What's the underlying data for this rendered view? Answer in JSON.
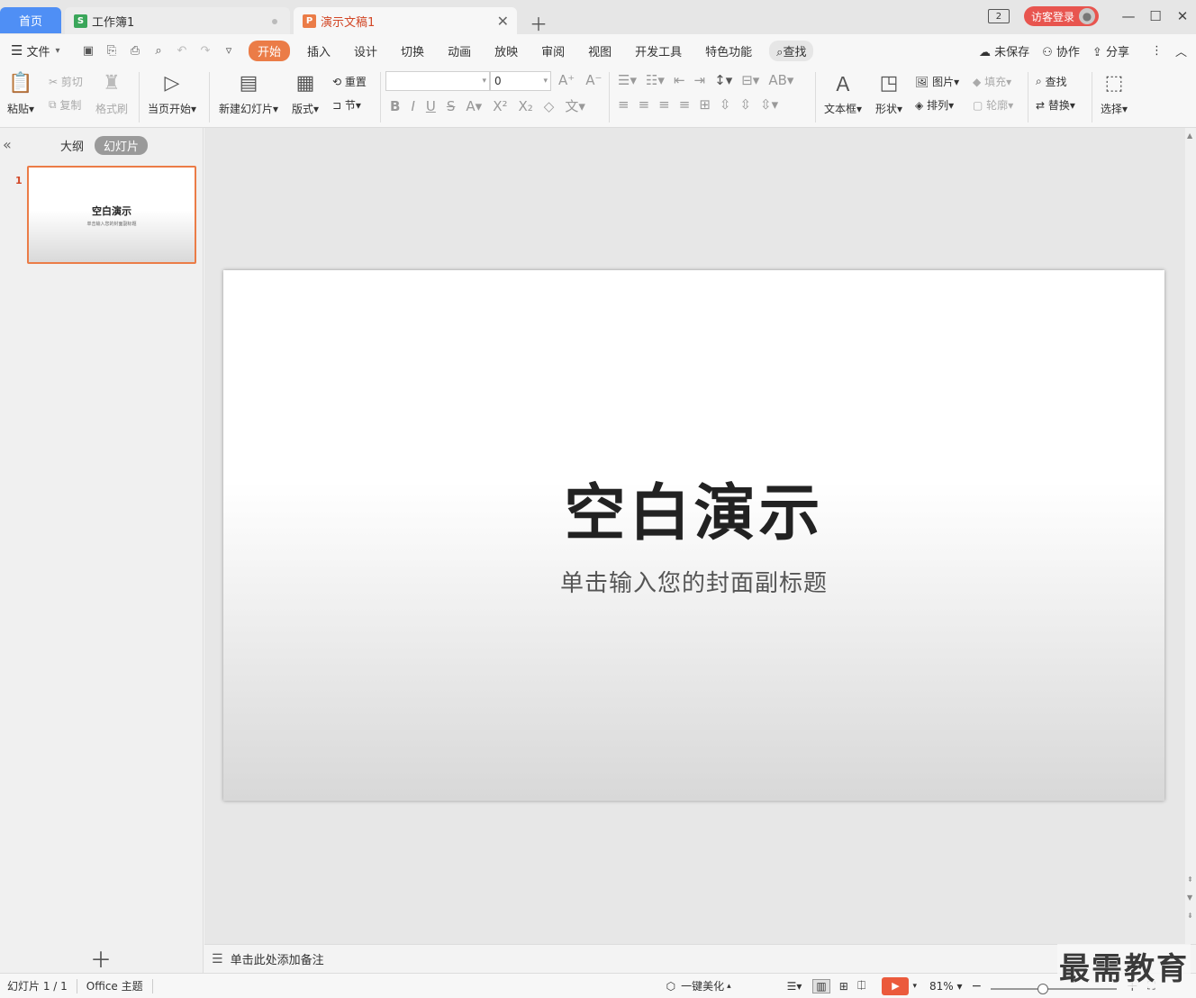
{
  "tabs": {
    "home": "首页",
    "workbook": "工作簿1",
    "presentation": "演示文稿1"
  },
  "window": {
    "badge": "2",
    "login": "访客登录"
  },
  "menu": {
    "file": "文件",
    "items": [
      "开始",
      "插入",
      "设计",
      "切换",
      "动画",
      "放映",
      "审阅",
      "视图",
      "开发工具",
      "特色功能"
    ],
    "search": "查找",
    "unsaved": "未保存",
    "collab": "协作",
    "share": "分享"
  },
  "ribbon": {
    "paste": "粘贴",
    "cut": "剪切",
    "copy": "复制",
    "format_painter": "格式刷",
    "from_current": "当页开始",
    "new_slide": "新建幻灯片",
    "layout": "版式",
    "reset": "重置",
    "section": "节",
    "font_name": "",
    "font_size": "0",
    "textbox": "文本框",
    "shape": "形状",
    "picture": "图片",
    "arrange": "排列",
    "fill": "填充",
    "outline": "轮廓",
    "find": "查找",
    "replace": "替换",
    "select": "选择"
  },
  "left_panel": {
    "outline_tab": "大纲",
    "slides_tab": "幻灯片",
    "slide_number": "1",
    "thumb_title": "空白演示",
    "thumb_subtitle": "单击输入您的封面副标题"
  },
  "slide": {
    "title": "空白演示",
    "subtitle": "单击输入您的封面副标题"
  },
  "notes": {
    "placeholder": "单击此处添加备注"
  },
  "status": {
    "slide_counter": "幻灯片 1 / 1",
    "theme": "Office 主题",
    "beautify": "一键美化",
    "zoom": "81%"
  },
  "watermark": "最需教育",
  "colors": {
    "accent": "#eb7c47",
    "home_tab": "#4f8ff5",
    "login": "#e8554f",
    "play": "#eb5a3c"
  }
}
